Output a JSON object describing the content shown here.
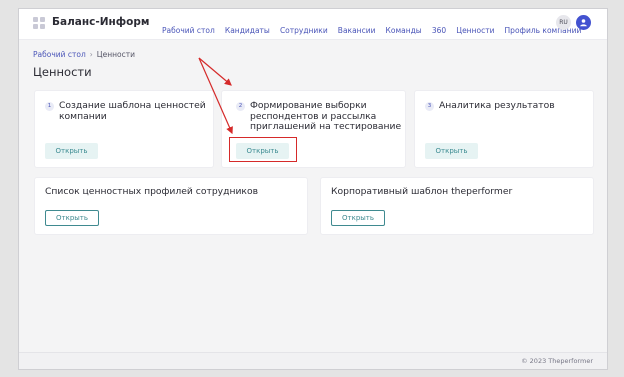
{
  "header": {
    "brand": "Баланс-Информ",
    "nav": [
      "Рабочий стол",
      "Кандидаты",
      "Сотрудники",
      "Вакансии",
      "Команды",
      "360",
      "Ценности",
      "Профиль компании"
    ],
    "lang": "RU"
  },
  "breadcrumb": {
    "home": "Рабочий стол",
    "separator": "›",
    "current": "Ценности"
  },
  "page_title": "Ценности",
  "steps": [
    {
      "num": "1",
      "title": "Создание шаблона ценностей компании",
      "button": "Открыть"
    },
    {
      "num": "2",
      "title": "Формирование выборки респондентов и рассылка приглашений на тестирование",
      "button": "Открыть"
    },
    {
      "num": "3",
      "title": "Аналитика результатов",
      "button": "Открыть"
    }
  ],
  "cards": [
    {
      "title": "Список ценностных профилей сотрудников",
      "button": "Открыть"
    },
    {
      "title": "Корпоративный шаблон theperformer",
      "button": "Открыть"
    }
  ],
  "footer": "© 2023 Theperformer",
  "colors": {
    "accent": "#4352d0",
    "teal": "#3f8a90",
    "annotation": "#d52a2a"
  }
}
